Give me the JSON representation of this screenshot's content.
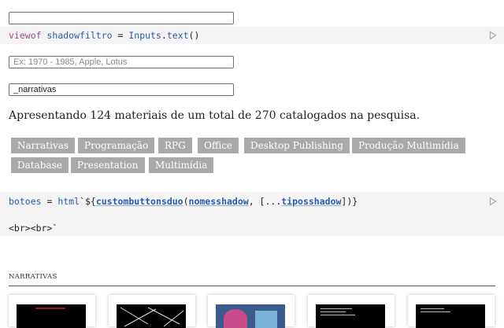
{
  "inputs": {
    "top_value": "",
    "search_placeholder": "Ex: 1970 - 1985, Apple, Lotus",
    "filter_value": "_narrativas"
  },
  "code": {
    "line1": {
      "kw": "viewof",
      "name": "shadowfiltro",
      "op": " = ",
      "obj": "Inputs",
      "dot": ".",
      "fn": "text",
      "args": "()"
    },
    "line2": {
      "name": "botoes",
      "op": " = ",
      "tag": "html",
      "tpl_open": "`${",
      "fn": "custombuttonsduo",
      "p1": "(",
      "arg1": "nomesshadow",
      "sep": ", [...",
      "arg2": "tiposshadow",
      "tail": "])}"
    },
    "line3": "<br><br>`"
  },
  "summary": "Apresentando 124 materiais de um total de 270 catalogados na pesquisa.",
  "buttons": {
    "row1": [
      "Narrativas",
      "Programação",
      "RPG",
      "Office",
      "Desktop Publishing",
      "Produção Multimídia"
    ],
    "row2": [
      "Database",
      "Presentation",
      "Multimídia"
    ]
  },
  "section": {
    "label": "NARRATIVAS"
  },
  "colors": {
    "button_bg": "#a9a9a9",
    "cell_bg": "#f4f4f4"
  },
  "icons": {
    "run": "play-icon"
  }
}
